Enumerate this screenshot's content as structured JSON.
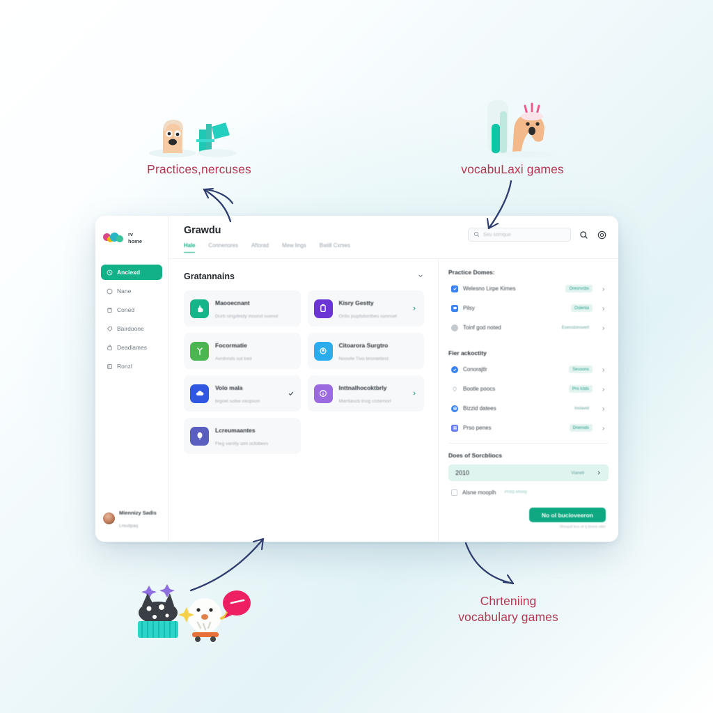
{
  "annotations": [
    {
      "id": "top-left",
      "text": "Practices,nercuses"
    },
    {
      "id": "top-right",
      "text": "vocabuLaxi games"
    },
    {
      "id": "bottom-right-l1",
      "text": "Chrteniing"
    },
    {
      "id": "bottom-right-l2",
      "text": "vocabulary games"
    }
  ],
  "colors": {
    "accent_teal": "#12b187",
    "cta_green": "#0fa882",
    "annotation_crimson": "#b03a52",
    "arrow_navy": "#2e3d6e",
    "badge_bg": "#e3f4f0",
    "badge_text": "#1f9c86",
    "highlight_row": "#dff3ef"
  },
  "sidebar": {
    "logo": {
      "line1": "rv",
      "line2": "home",
      "icon": "brand-dots-logo"
    },
    "items": [
      {
        "label": "Anciexd",
        "icon": "clock-icon",
        "active": true
      },
      {
        "label": "Nane",
        "icon": "circle-icon",
        "active": false
      },
      {
        "label": "Coned",
        "icon": "clipboard-icon",
        "active": false
      },
      {
        "label": "Bairdoone",
        "icon": "tag-icon",
        "active": false
      },
      {
        "label": "Deadlames",
        "icon": "bag-icon",
        "active": false
      },
      {
        "label": "Ronzl",
        "icon": "book-icon",
        "active": false
      }
    ],
    "user": {
      "name": "Miennizy Sadis",
      "subtitle": "Lreuitpaq",
      "avatar": "user-avatar"
    }
  },
  "header": {
    "title": "Grawdu",
    "tabs": [
      {
        "label": "Hale",
        "active": true
      },
      {
        "label": "Connenores",
        "active": false
      },
      {
        "label": "Aftorad",
        "active": false
      },
      {
        "label": "Mew lings",
        "active": false
      },
      {
        "label": "Bwiill Cxmes",
        "active": false
      }
    ],
    "search": {
      "placeholder": "Seu sorrique",
      "icon": "search-icon"
    },
    "search_button_icon": "search-icon",
    "account_button_icon": "account-circle-icon"
  },
  "center": {
    "title": "Gratannains",
    "collapse_icon": "chevron-down-icon",
    "cards_left": [
      {
        "title": "Maooecnant",
        "subtitle": "Durb singdetdy moond soenol",
        "icon": "hand-icon",
        "icon_color": "#16b589",
        "end": "none"
      },
      {
        "title": "Focormatie",
        "subtitle": "Avrdnnds sut ked",
        "icon": "leaf-icon",
        "icon_color": "#4bb551",
        "end": "none"
      },
      {
        "title": "Volo mala",
        "subtitle": "brgoel sobw oxopson",
        "icon": "cloud-icon",
        "icon_color": "#2f57e0",
        "end": "check"
      },
      {
        "title": "Lcreumaantes",
        "subtitle": "Fleg vanlily omi ocfobees",
        "icon": "balloon-icon",
        "icon_color": "#5a5fbf",
        "end": "none"
      }
    ],
    "cards_right": [
      {
        "title": "Kisry Gestty",
        "subtitle": "Onlis jsupbdontbes sunnset",
        "icon": "doc-icon",
        "icon_color": "#6b35d6",
        "end": "chevron"
      },
      {
        "title": "Citoarora Surgtro",
        "subtitle": "Noovile Tivo tinsniettest",
        "icon": "recycle-icon",
        "icon_color": "#2bacee",
        "end": "none"
      },
      {
        "title": "Inttnalhocoktbrly",
        "subtitle": "Mwrtlascb tnog cozemorl",
        "icon": "info-icon",
        "icon_color": "#9a6ade",
        "end": "chevron"
      }
    ]
  },
  "rail": {
    "section1_title": "Practice Domes:",
    "section1_rows": [
      {
        "label": "Welesno Lirpe Kimes",
        "badge": "Oreorvcbs",
        "icon": "check-square-icon",
        "icon_color": "#3b82f6"
      },
      {
        "label": "Pilsy",
        "badge": "Oslenia",
        "icon": "card-icon",
        "icon_color": "#3b82f6"
      },
      {
        "label": "Toinf god noted",
        "badge": "Eoesstonsvert",
        "icon": "dot-icon",
        "icon_color": "#c3c9cf"
      }
    ],
    "section2_title": "Fier ackoctity",
    "section2_rows": [
      {
        "label": "Conorajtlr",
        "badge": "Sessons",
        "icon": "check-circle-icon",
        "icon_color": "#3b82f6"
      },
      {
        "label": "Bootle poocs",
        "badge": "Pro lctds",
        "icon": "pin-icon",
        "icon_color": "#c3c9cf"
      },
      {
        "label": "Bizzid datees",
        "badge": "Inslavid",
        "icon": "globe-icon",
        "icon_color": "#3b82f6"
      },
      {
        "label": "Prso penes",
        "badge": "Dnerods",
        "icon": "grid-icon",
        "icon_color": "#6b7ef0"
      }
    ],
    "section3_title": "Does of Sorcbliocs",
    "highlight_row": {
      "label": "2010",
      "action": "Vianeti",
      "chevron": "chevron-right-icon"
    },
    "checkbox_row": {
      "label": "Alsne mooplh",
      "badge": "Prorp khooy",
      "checked": false
    },
    "cta": {
      "label": "No ol bucioveeron",
      "note": "Shoquil kns ot tj bnesl oller"
    }
  }
}
